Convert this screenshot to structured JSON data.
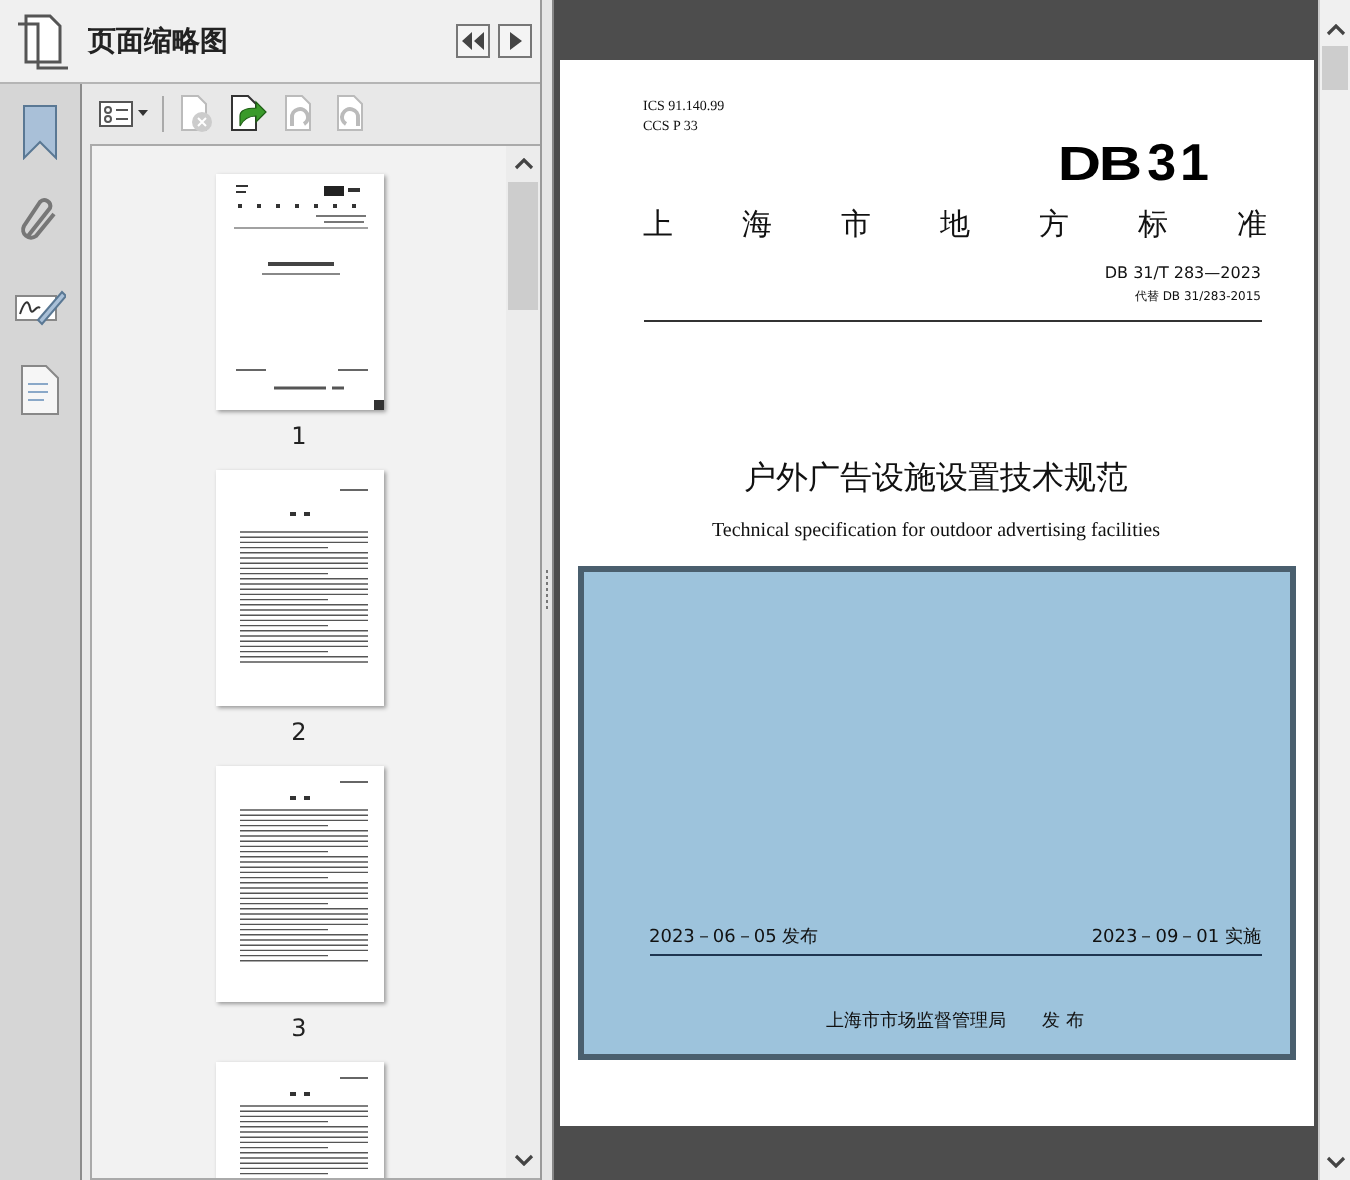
{
  "panel": {
    "title": "页面缩略图",
    "toolbar": [
      {
        "kind": "options",
        "disabled": false
      },
      {
        "kind": "delete",
        "disabled": true
      },
      {
        "kind": "insert",
        "disabled": false
      },
      {
        "kind": "rotate-ccw",
        "disabled": true
      },
      {
        "kind": "rotate-cw",
        "disabled": true
      }
    ],
    "thumbnails": [
      {
        "kind": "cover",
        "label": "1"
      },
      {
        "kind": "toc",
        "label": "2"
      },
      {
        "kind": "text",
        "label": "3"
      },
      {
        "kind": "text"
      }
    ]
  },
  "rail": [
    {
      "kind": "bookmark"
    },
    {
      "kind": "attachment"
    },
    {
      "kind": "signature"
    },
    {
      "kind": "layers"
    }
  ],
  "document": {
    "ics": "ICS  91.140.99",
    "ccs": "CCS  P 33",
    "logo_prefix": "DB",
    "logo_number": "31",
    "standard_type": "上海市地方标准",
    "code": "DB 31/T  283—2023",
    "replaces": "代替 DB 31/283-2015",
    "title_zh": "户外广告设施设置技术规范",
    "title_en": "Technical specification for outdoor advertising facilities",
    "issue_date": "2023－06－05 发布",
    "effective_date": "2023－09－01 实施",
    "issuer": "上海市市场监督管理局　　发 布"
  }
}
